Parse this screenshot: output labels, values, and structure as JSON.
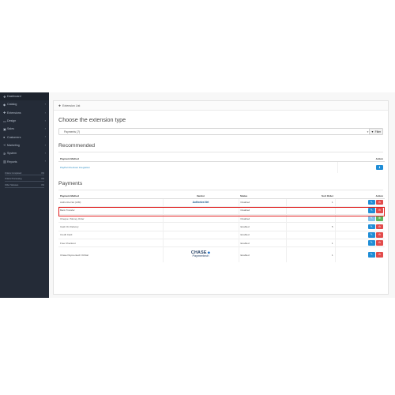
{
  "colors": {
    "sidebar": "#242b37",
    "link": "#2b8cc4",
    "edit_button": "#1f8dd6",
    "uninstall_button": "#e24b4b",
    "install_button": "#5cb85c",
    "highlight": "#e01e1e"
  },
  "sidebar": {
    "items": [
      {
        "label": "Dashboard",
        "icon": "dashboard-icon",
        "glyph": "❖",
        "chevron": ""
      },
      {
        "label": "Catalog",
        "icon": "tag-icon",
        "glyph": "◆",
        "chevron": "›"
      },
      {
        "label": "Extensions",
        "icon": "puzzle-icon",
        "glyph": "✚",
        "chevron": "›"
      },
      {
        "label": "Design",
        "icon": "monitor-icon",
        "glyph": "▭",
        "chevron": "›"
      },
      {
        "label": "Sales",
        "icon": "cart-icon",
        "glyph": "▣",
        "chevron": "›"
      },
      {
        "label": "Customers",
        "icon": "user-icon",
        "glyph": "●",
        "chevron": "›"
      },
      {
        "label": "Marketing",
        "icon": "share-icon",
        "glyph": "≺",
        "chevron": "›"
      },
      {
        "label": "System",
        "icon": "gear-icon",
        "glyph": "✲",
        "chevron": "›"
      },
      {
        "label": "Reports",
        "icon": "bar-chart-icon",
        "glyph": "▥",
        "chevron": "›"
      }
    ],
    "stats": [
      {
        "label": "Orders Completed",
        "value": "0%",
        "fill": 0
      },
      {
        "label": "Orders Processing",
        "value": "0%",
        "fill": 0
      },
      {
        "label": "Other Statuses",
        "value": "0%",
        "fill": 0
      }
    ]
  },
  "panel": {
    "heading": "Extension List",
    "choose_title": "Choose the extension type",
    "select_value": "Payments (7)",
    "filter_label": "Filter",
    "recommended_title": "Recommended",
    "payments_title": "Payments"
  },
  "recommended": {
    "headers": {
      "method": "Payment Method",
      "action": "Action"
    },
    "rows": [
      {
        "method": "PayPal Checkout Integration"
      }
    ]
  },
  "payments": {
    "headers": {
      "method": "Payment Method",
      "vendor": "Vendor",
      "status": "Status",
      "sort": "Sort Order",
      "action": "Action"
    },
    "vendor_logos": {
      "authorize": "Authorize.Net",
      "chase_name": "CHASE",
      "chase_mark": "◆",
      "chase_sub": "Paymentech"
    },
    "rows": [
      {
        "method": "Authorize.Net (AIM)",
        "status": "Disabled",
        "sort": "1"
      },
      {
        "method": "Bank Transfer",
        "status": "Disabled",
        "sort": ""
      },
      {
        "method": "Cheque / Money Order",
        "status": "Disabled",
        "sort": ""
      },
      {
        "method": "Cash On Delivery",
        "status": "Enabled",
        "sort": "5"
      },
      {
        "method": "Credit Card",
        "status": "Enabled",
        "sort": ""
      },
      {
        "method": "Free Checkout",
        "status": "Enabled",
        "sort": "1"
      },
      {
        "method": "Chase Paymentech Orbital",
        "status": "Enabled",
        "sort": "1"
      }
    ]
  }
}
